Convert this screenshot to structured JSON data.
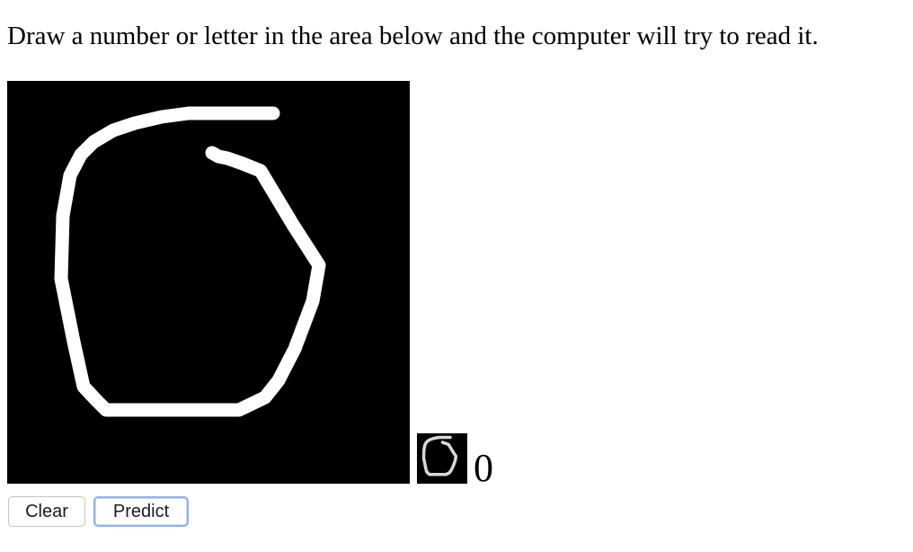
{
  "instructions": "Draw a number or letter in the area below and the computer will try to read it.",
  "canvas": {
    "background": "#000000",
    "stroke_color": "#ffffff"
  },
  "prediction": {
    "value": "0"
  },
  "buttons": {
    "clear_label": "Clear",
    "predict_label": "Predict"
  },
  "colors": {
    "focus_ring": "#8fb3ea"
  }
}
